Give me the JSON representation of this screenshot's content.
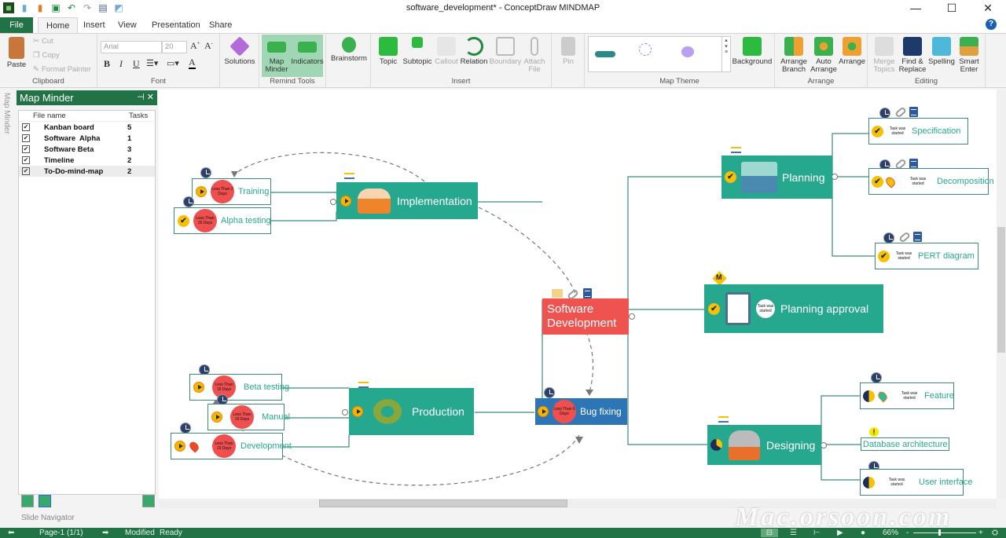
{
  "window": {
    "title": "software_development* - ConceptDraw MINDMAP",
    "controls": [
      "minimize",
      "maximize",
      "close"
    ]
  },
  "quick_access": [
    "app-icon",
    "new-icon",
    "open-icon",
    "save-icon",
    "undo-icon",
    "redo-icon",
    "print-icon",
    "print-preview-icon"
  ],
  "tabs": [
    {
      "label": "File"
    },
    {
      "label": "Home",
      "active": true
    },
    {
      "label": "Insert"
    },
    {
      "label": "View"
    },
    {
      "label": "Presentation"
    },
    {
      "label": "Share"
    }
  ],
  "ribbon": {
    "clipboard": {
      "label": "Clipboard",
      "paste": "Paste",
      "cut": "Cut",
      "copy": "Copy",
      "format_painter": "Format Painter"
    },
    "font": {
      "label": "Font",
      "family": "Arial",
      "size": "20",
      "bold": "B",
      "italic": "I",
      "underline": "U",
      "color": "A"
    },
    "solutions": {
      "label": "Solutions"
    },
    "remind_tools": {
      "label": "Remind Tools",
      "map_minder": "Map Minder",
      "indicators": "Indicators"
    },
    "brainstorm": {
      "label": "Brainstorm"
    },
    "insert": {
      "label": "Insert",
      "topic": "Topic",
      "subtopic": "Subtopic",
      "callout": "Callout",
      "relation": "Relation",
      "boundary": "Boundary",
      "attach_file": "Attach File"
    },
    "pin": {
      "label": "Pin"
    },
    "map_theme": {
      "label": "Map Theme",
      "background": "Background"
    },
    "arrange": {
      "label": "Arrange",
      "arrange_branch": "Arrange Branch",
      "auto_arrange": "Auto Arrange",
      "arrange": "Arrange"
    },
    "editing": {
      "label": "Editing",
      "merge_topics": "Merge Topics",
      "find_replace": "Find & Replace",
      "spelling": "Spelling",
      "smart_enter": "Smart Enter"
    }
  },
  "side_tab": "Map Minder",
  "map_minder": {
    "title": "Map Minder",
    "columns": {
      "file_name": "File name",
      "tasks": "Tasks"
    },
    "rows": [
      {
        "name": "Kanban board",
        "tasks": "5",
        "checked": true
      },
      {
        "name": "Software  Alpha",
        "tasks": "1",
        "checked": true
      },
      {
        "name": "Software Beta",
        "tasks": "3",
        "checked": true
      },
      {
        "name": "Timeline",
        "tasks": "2",
        "checked": true
      },
      {
        "name": "To-Do-mind-map",
        "tasks": "2",
        "checked": true,
        "selected": true
      }
    ],
    "slide_navigator": "Slide Navigator"
  },
  "mindmap": {
    "central": {
      "title": "Software Development",
      "color": "#ef5350"
    },
    "colors": {
      "teal": "#26a88e",
      "blue": "#2e75b6",
      "red_badge": "#ef4f4f",
      "check": "#f7c000"
    },
    "nodes": {
      "implementation": {
        "title": "Implementation",
        "children": [
          {
            "title": "Training",
            "badge": "Less Than 2 Days"
          },
          {
            "title": "Alpha testing",
            "badge": "Less Than 25 Days"
          }
        ]
      },
      "production": {
        "title": "Production",
        "children": [
          {
            "title": "Beta testing",
            "badge": "Less Than 19 Days"
          },
          {
            "title": "Manual",
            "badge": "Less Than 19 Days"
          },
          {
            "title": "Development",
            "badge": "Less Than 19 Days"
          }
        ]
      },
      "bug_fixing": {
        "title": "Bug fixing",
        "badge": "Less Than 6 Days"
      },
      "planning": {
        "title": "Planning",
        "children": [
          {
            "title": "Specification",
            "badge": "Task was started"
          },
          {
            "title": "Decomposition",
            "badge": "Task was started"
          },
          {
            "title": "PERT diagram",
            "badge": "Task was started"
          }
        ]
      },
      "planning_approval": {
        "title": "Planning approval",
        "badge": "Task was started",
        "marker": "M"
      },
      "designing": {
        "title": "Designing",
        "children": [
          {
            "title": "Feature",
            "badge": "Task was started"
          },
          {
            "title": "Database architecture"
          },
          {
            "title": "User interface",
            "badge": "Task was started"
          }
        ]
      }
    }
  },
  "status_bar": {
    "page": "Page-1 (1/1)",
    "modified": "Modified",
    "ready": "Ready",
    "zoom": "66%",
    "zoom_fraction": 0.4
  },
  "watermark": "Mac.orsoon.com"
}
